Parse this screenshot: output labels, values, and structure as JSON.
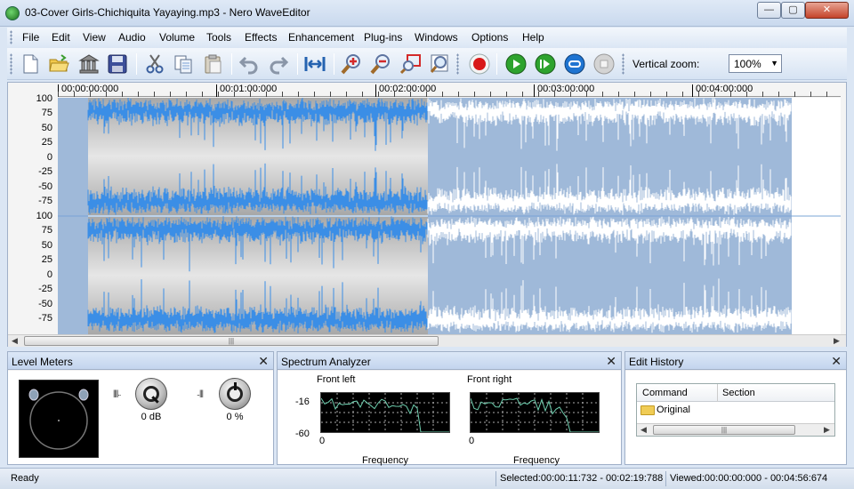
{
  "window": {
    "title": "03-Cover Girls-Chichiquita Yayaying.mp3 - Nero WaveEditor",
    "min_glyph": "—",
    "max_glyph": "▢",
    "close_glyph": "✕"
  },
  "menu": [
    "File",
    "Edit",
    "View",
    "Audio",
    "Volume",
    "Tools",
    "Effects",
    "Enhancement",
    "Plug-ins",
    "Windows",
    "Options",
    "Help"
  ],
  "toolbar": {
    "icons": [
      "new-file-icon",
      "open-folder-icon",
      "library-icon",
      "save-icon",
      "cut-icon",
      "copy-icon",
      "paste-icon",
      "undo-icon",
      "redo-icon",
      "zoom-fit-icon",
      "zoom-in-icon",
      "zoom-out-icon",
      "zoom-selection-icon",
      "zoom-find-icon",
      "record-icon",
      "play-icon",
      "play-from-cursor-icon",
      "loop-icon",
      "stop-icon"
    ],
    "vertical_zoom_label": "Vertical zoom:",
    "vertical_zoom_value": "100%"
  },
  "timeline": {
    "labels": [
      "00:00:00:000",
      "00:01:00:000",
      "00:02:00:000",
      "00:03:00:000",
      "00:04:00:000"
    ]
  },
  "yaxis": {
    "channel1": [
      "100",
      "75",
      "50",
      "25",
      "0",
      "-25",
      "-50",
      "-75"
    ],
    "channel2": [
      "100",
      "75",
      "50",
      "25",
      "0",
      "-25",
      "-50",
      "-75"
    ]
  },
  "panels": {
    "level_meters": {
      "title": "Level Meters",
      "gain_value": "0 dB",
      "balance_value": "0 %"
    },
    "spectrum": {
      "title": "Spectrum Analyzer",
      "left_title": "Front left",
      "right_title": "Front right",
      "y_top": "-16",
      "y_bottom": "-60",
      "x_start": "0",
      "x_label": "Frequency"
    },
    "edit_history": {
      "title": "Edit History",
      "col_command": "Command",
      "col_section": "Section",
      "rows": [
        "Original"
      ]
    },
    "close_glyph": "✕"
  },
  "status": {
    "state": "Ready",
    "selected": "Selected:00:00:11:732 - 00:02:19:788",
    "viewed": "Viewed:00:00:00:000 - 00:04:56:674"
  },
  "colors": {
    "selection_bg": "#c4c4c4",
    "wave_selected": "#3b8ee6",
    "wave_unselected_bg": "#9fb9d9",
    "wave_unselected_fg": "#ffffff"
  }
}
